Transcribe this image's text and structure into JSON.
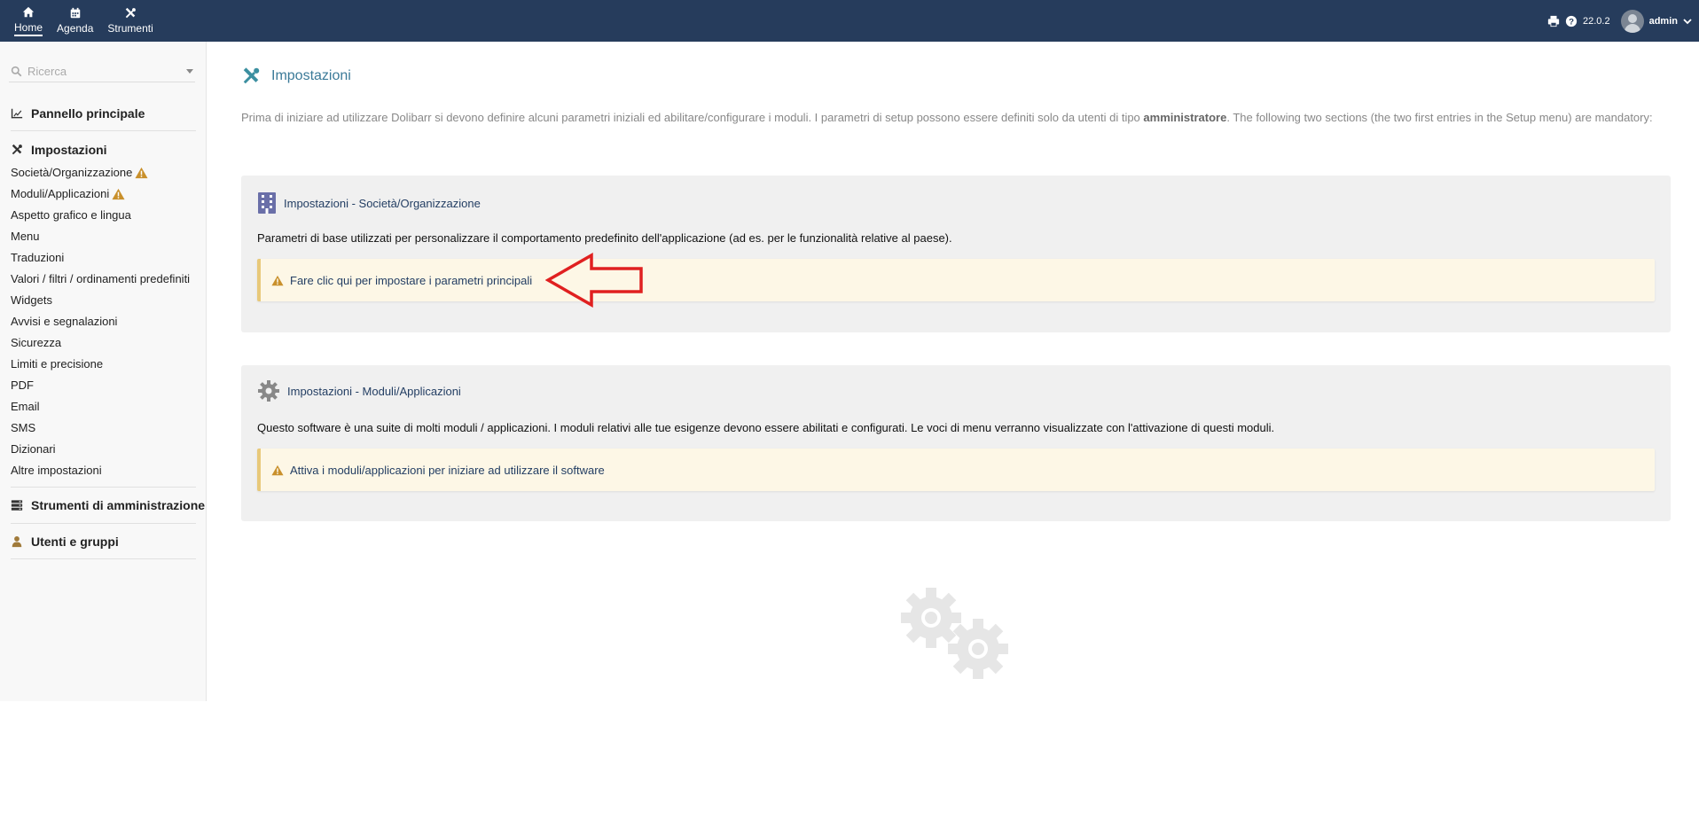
{
  "topnav": {
    "items": [
      {
        "label": "Home",
        "icon": "home-icon",
        "active": true
      },
      {
        "label": "Agenda",
        "icon": "calendar-icon",
        "active": false
      },
      {
        "label": "Strumenti",
        "icon": "tools-icon",
        "active": false
      }
    ],
    "version": "22.0.2",
    "username": "admin"
  },
  "sidebar": {
    "search_placeholder": "Ricerca",
    "pannello": "Pannello principale",
    "impostazioni": "Impostazioni",
    "sub_items": [
      "Società/Organizzazione",
      "Moduli/Applicazioni",
      "Aspetto grafico e lingua",
      "Menu",
      "Traduzioni",
      "Valori / filtri / ordinamenti predefiniti",
      "Widgets",
      "Avvisi e segnalazioni",
      "Sicurezza",
      "Limiti e precisione",
      "PDF",
      "Email",
      "SMS",
      "Dizionari",
      "Altre impostazioni"
    ],
    "strumenti_admin": "Strumenti di amministrazione",
    "utenti": "Utenti e gruppi"
  },
  "main": {
    "title": "Impostazioni",
    "intro_part1": "Prima di iniziare ad utilizzare Dolibarr si devono definire alcuni parametri iniziali ed abilitare/configurare i moduli. I parametri di setup possono essere definiti solo da utenti di tipo ",
    "intro_bold": "amministratore",
    "intro_part2": ". The following two sections (the two first entries in the Setup menu) are mandatory:",
    "box1": {
      "title": "Impostazioni - Società/Organizzazione",
      "desc": "Parametri di base utilizzati per personalizzare il comportamento predefinito dell'applicazione (ad es. per le funzionalità relative al paese).",
      "alert": "Fare clic qui per impostare i parametri principali"
    },
    "box2": {
      "title": "Impostazioni - Moduli/Applicazioni",
      "desc": "Questo software è una suite di molti moduli / applicazioni. I moduli relativi alle tue esigenze devono essere abilitati e configurati. Le voci di menu verranno visualizzate con l'attivazione di questi moduli.",
      "alert": "Attiva i moduli/applicazioni per iniziare ad utilizzare il software"
    }
  },
  "colors": {
    "topbar": "#263c5c",
    "link": "#233e63",
    "title": "#3b7a98",
    "alert_bg": "#fdf7e6",
    "arrow": "#e02020"
  }
}
